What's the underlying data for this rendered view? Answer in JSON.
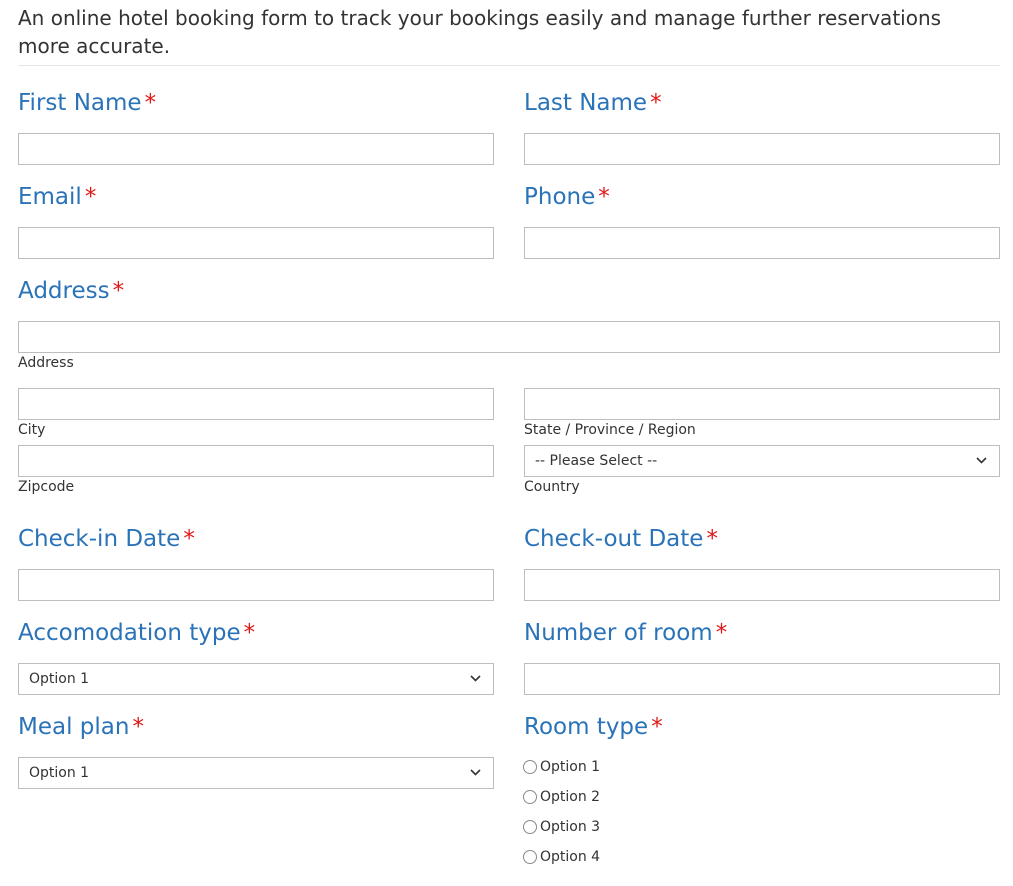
{
  "intro": "An online hotel booking form to track your bookings easily and manage further reservations more accurate.",
  "required_mark": "*",
  "fields": {
    "first_name": {
      "label": "First Name",
      "value": ""
    },
    "last_name": {
      "label": "Last Name",
      "value": ""
    },
    "email": {
      "label": "Email",
      "value": ""
    },
    "phone": {
      "label": "Phone",
      "value": ""
    },
    "address": {
      "label": "Address",
      "street_sublabel": "Address",
      "city_sublabel": "City",
      "state_sublabel": "State / Province / Region",
      "zip_sublabel": "Zipcode",
      "country_sublabel": "Country",
      "country_selected": "-- Please Select --"
    },
    "checkin": {
      "label": "Check-in Date",
      "value": ""
    },
    "checkout": {
      "label": "Check-out Date",
      "value": ""
    },
    "accommodation": {
      "label": "Accomodation type",
      "selected": "Option 1"
    },
    "rooms": {
      "label": "Number of room",
      "value": ""
    },
    "meal_plan": {
      "label": "Meal plan",
      "selected": "Option 1"
    },
    "room_type": {
      "label": "Room type",
      "options": [
        "Option 1",
        "Option 2",
        "Option 3",
        "Option 4"
      ]
    }
  },
  "colors": {
    "label": "#2a73b8",
    "required": "#e01818",
    "border": "#bdbdbd"
  },
  "icons": {
    "dropdown": "chevron-down-icon",
    "radio": "radio-unchecked"
  }
}
